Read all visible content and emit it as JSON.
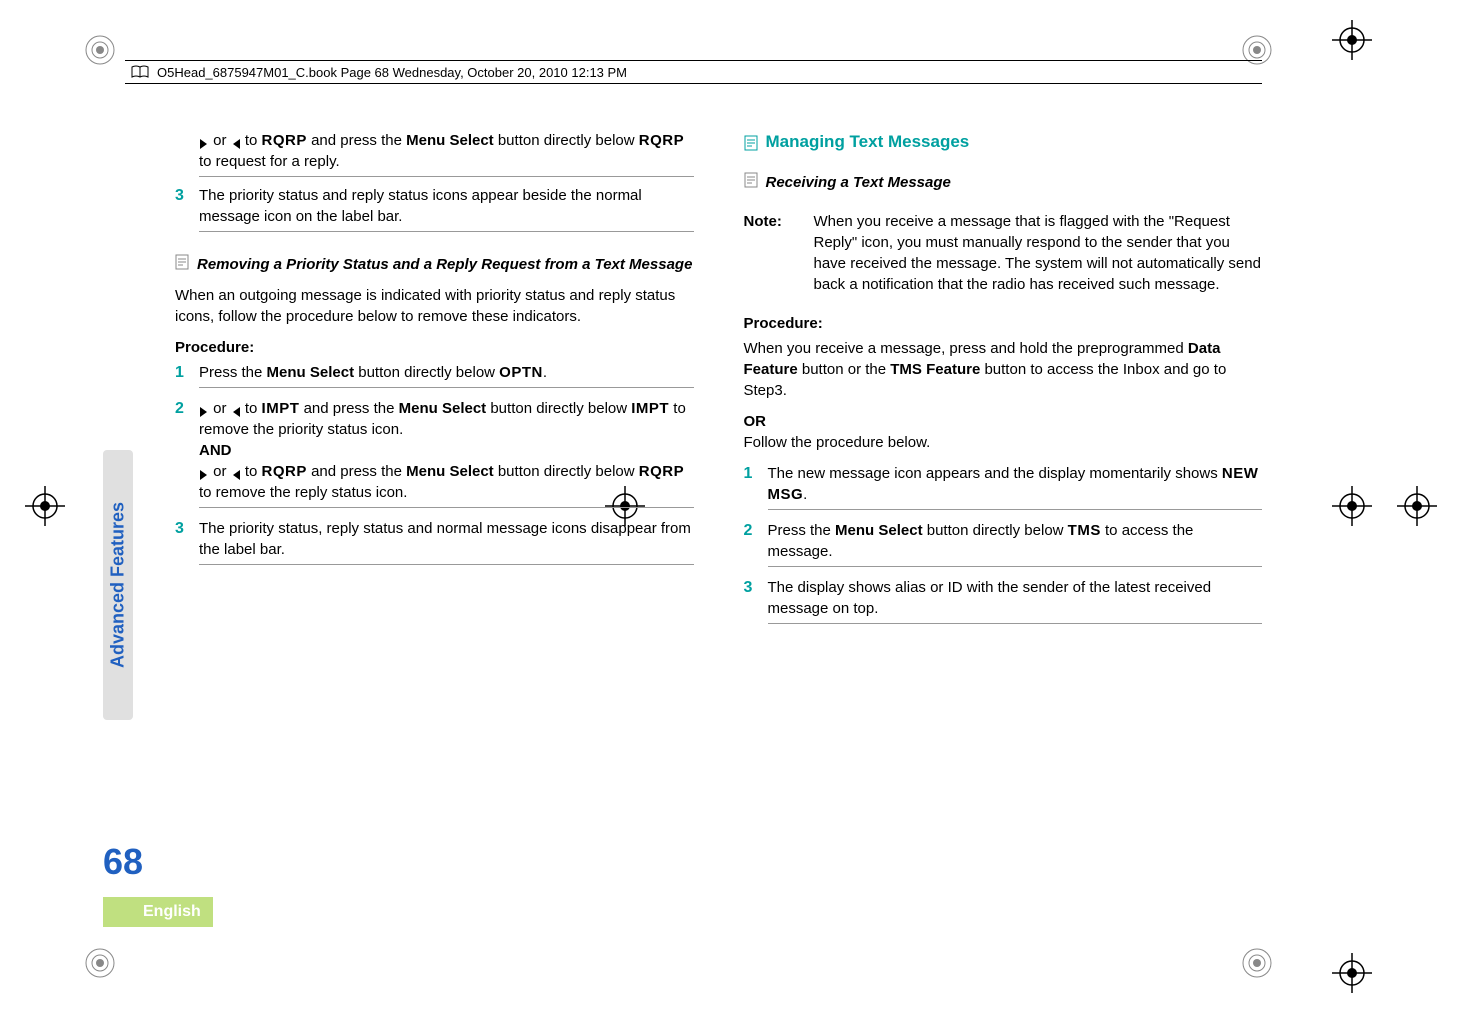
{
  "header": {
    "text": "O5Head_6875947M01_C.book  Page 68  Wednesday, October 20, 2010  12:13 PM"
  },
  "leftCol": {
    "continuation": {
      "pre1": "or",
      "pre2": "to",
      "code1": "RQRP",
      "text1": "and press the",
      "bold1": "Menu Select",
      "text2": "button directly below",
      "code2": "RQRP",
      "text3": "to request for a reply."
    },
    "step3": {
      "num": "3",
      "text": "The priority status and reply status icons appear beside the normal message icon on the label bar."
    },
    "subsection1": {
      "title": "Removing a Priority Status and a Reply Request from a Text Message"
    },
    "intro": "When an outgoing message is indicated with priority status and reply status icons, follow the procedure below to remove these indicators.",
    "procLabel": "Procedure:",
    "p1": {
      "num": "1",
      "text1": "Press the",
      "bold1": "Menu Select",
      "text2": "button directly below",
      "code1": "OPTN",
      "text3": "."
    },
    "p2": {
      "num": "2",
      "pre1": "or",
      "pre2": "to",
      "code1": "IMPT",
      "text1": "and press the",
      "bold1": "Menu Select",
      "text2": "button directly below",
      "code2": "IMPT",
      "text3": "to remove the priority status icon.",
      "and": "AND",
      "b_pre1": "or",
      "b_pre2": "to",
      "b_code1": "RQRP",
      "b_text1": "and press the",
      "b_bold1": "Menu Select",
      "b_text2": "button directly below",
      "b_code2": "RQRP",
      "b_text3": "to remove the reply status icon."
    },
    "p3": {
      "num": "3",
      "text": "The priority status, reply status and normal message icons disappear from the label bar."
    }
  },
  "rightCol": {
    "heading": "Managing Text Messages",
    "sub1": {
      "title": "Receiving a Text Message"
    },
    "note": {
      "label": "Note:",
      "text": "When you receive a message that is flagged with the \"Request Reply\" icon, you must manually respond to the sender that you have received the message. The system will not automatically send back a notification that the radio has received such message."
    },
    "procLabel": "Procedure:",
    "intro1a": "When you receive a message, press and hold the preprogrammed",
    "intro1b": "Data Feature",
    "intro1c": "button or the",
    "intro1d": "TMS Feature",
    "intro1e": "button to access the Inbox and go to Step3.",
    "or": "OR",
    "intro2": "Follow the procedure below.",
    "s1": {
      "num": "1",
      "text1": "The new message icon appears and the display momentarily shows",
      "code1": "NEW MSG",
      "text2": "."
    },
    "s2": {
      "num": "2",
      "text1": "Press the",
      "bold1": "Menu Select",
      "text2": "button directly below",
      "code1": "TMS",
      "text3": "to access the message."
    },
    "s3": {
      "num": "3",
      "text": "The display shows alias or ID with the sender of the latest received message on top."
    }
  },
  "sideTab": "Advanced Features",
  "pageNum": "68",
  "lang": "English"
}
